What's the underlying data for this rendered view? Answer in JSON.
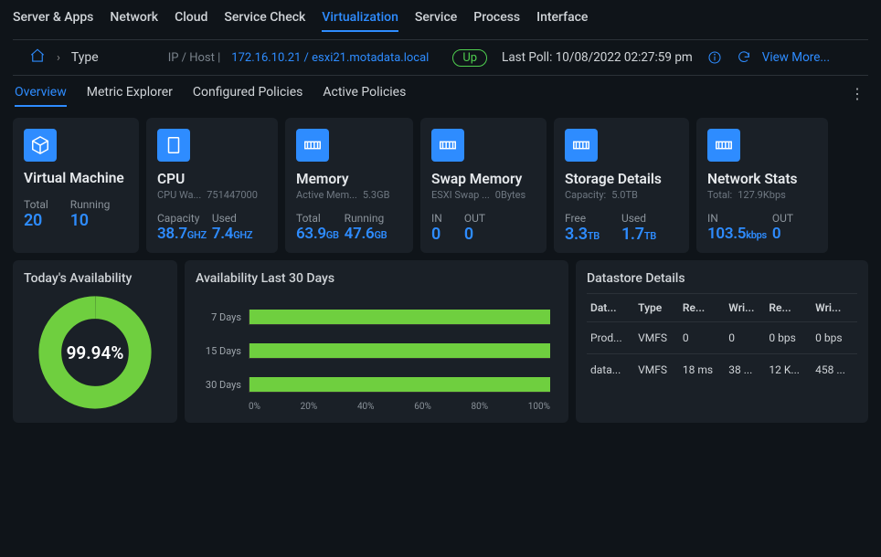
{
  "top_nav": {
    "items": [
      "Server & Apps",
      "Network",
      "Cloud",
      "Service Check",
      "Virtualization",
      "Service",
      "Process",
      "Interface"
    ],
    "active_index": 4
  },
  "breadcrumb": {
    "type_label": "Type",
    "host_label": "IP / Host |",
    "host_value": "172.16.10.21 / esxi21.motadata.local",
    "status": "Up",
    "last_poll_label": "Last Poll:",
    "last_poll_value": "10/08/2022 02:27:59 pm",
    "view_more": "View More..."
  },
  "sub_nav": {
    "items": [
      "Overview",
      "Metric Explorer",
      "Configured Policies",
      "Active Policies"
    ],
    "active_index": 0
  },
  "cards": {
    "vm": {
      "title": "Virtual Machine",
      "sub1": "",
      "sub2": "",
      "l1": "Total",
      "v1": "20",
      "u1": "",
      "l2": "Running",
      "v2": "10",
      "u2": ""
    },
    "cpu": {
      "title": "CPU",
      "sub1": "CPU Wa...",
      "sub2": "751447000",
      "l1": "Capacity",
      "v1": "38.7",
      "u1": "GHZ",
      "l2": "Used",
      "v2": "7.4",
      "u2": "GHZ"
    },
    "memory": {
      "title": "Memory",
      "sub1": "Active Mem...",
      "sub2": "5.3GB",
      "l1": "Total",
      "v1": "63.9",
      "u1": "GB",
      "l2": "Running",
      "v2": "47.6",
      "u2": "GB"
    },
    "swap": {
      "title": "Swap Memory",
      "sub1": "ESXI Swap ...",
      "sub2": "0Bytes",
      "l1": "IN",
      "v1": "0",
      "u1": "",
      "l2": "OUT",
      "v2": "0",
      "u2": ""
    },
    "storage": {
      "title": "Storage Details",
      "sub1": "Capacity:",
      "sub2": "5.0TB",
      "l1": "Free",
      "v1": "3.3",
      "u1": "TB",
      "l2": "Used",
      "v2": "1.7",
      "u2": "TB"
    },
    "network": {
      "title": "Network Stats",
      "sub1": "Total:",
      "sub2": "127.9Kbps",
      "l1": "IN",
      "v1": "103.5",
      "u1": "kbps",
      "l2": "OUT",
      "v2": "0",
      "u2": ""
    }
  },
  "availability_today": {
    "title": "Today's Availability",
    "pct": "99.94%",
    "value": 99.94
  },
  "chart_data": {
    "type": "bar",
    "title": "Availability Last 30 Days",
    "orientation": "horizontal",
    "categories": [
      "7 Days",
      "15 Days",
      "30 Days"
    ],
    "values": [
      100,
      100,
      100
    ],
    "xlabel": "",
    "ylabel": "",
    "xlim": [
      0,
      100
    ],
    "xticks": [
      "0%",
      "20%",
      "40%",
      "60%",
      "80%",
      "100%"
    ]
  },
  "datastore": {
    "title": "Datastore Details",
    "headers": [
      "Dat...",
      "Type",
      "Re...",
      "Wri...",
      "Re...",
      "Wri..."
    ],
    "rows": [
      [
        "Prod...",
        "VMFS",
        "0",
        "0",
        "0 bps",
        "0 bps"
      ],
      [
        "data...",
        "VMFS",
        "18 ms",
        "38 ...",
        "12 K...",
        "458 ..."
      ]
    ]
  }
}
